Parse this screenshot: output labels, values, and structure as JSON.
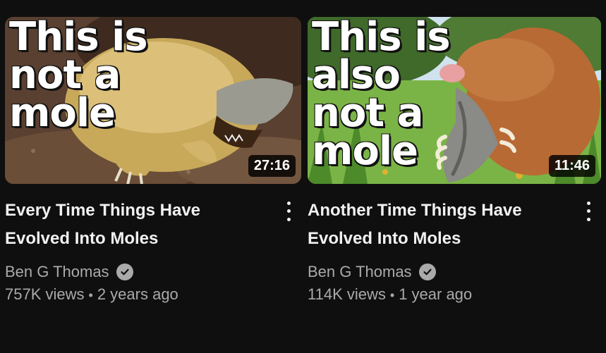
{
  "videos": [
    {
      "thumb_lines": [
        "This is",
        "not a",
        "mole"
      ],
      "duration": "27:16",
      "title_lines": [
        "Every Time Things Have",
        "Evolved Into Moles"
      ],
      "channel": "Ben G Thomas",
      "views": "757K views",
      "separator": "•",
      "age": "2 years ago"
    },
    {
      "thumb_lines": [
        "This is",
        "also",
        "not a",
        "mole"
      ],
      "duration": "11:46",
      "title_lines": [
        "Another Time Things Have",
        "Evolved Into Moles"
      ],
      "channel": "Ben G Thomas",
      "views": "114K views",
      "separator": "•",
      "age": "1 year ago"
    }
  ],
  "icons": {
    "verified": "verified-check-icon",
    "menu": "more-vert-icon"
  }
}
